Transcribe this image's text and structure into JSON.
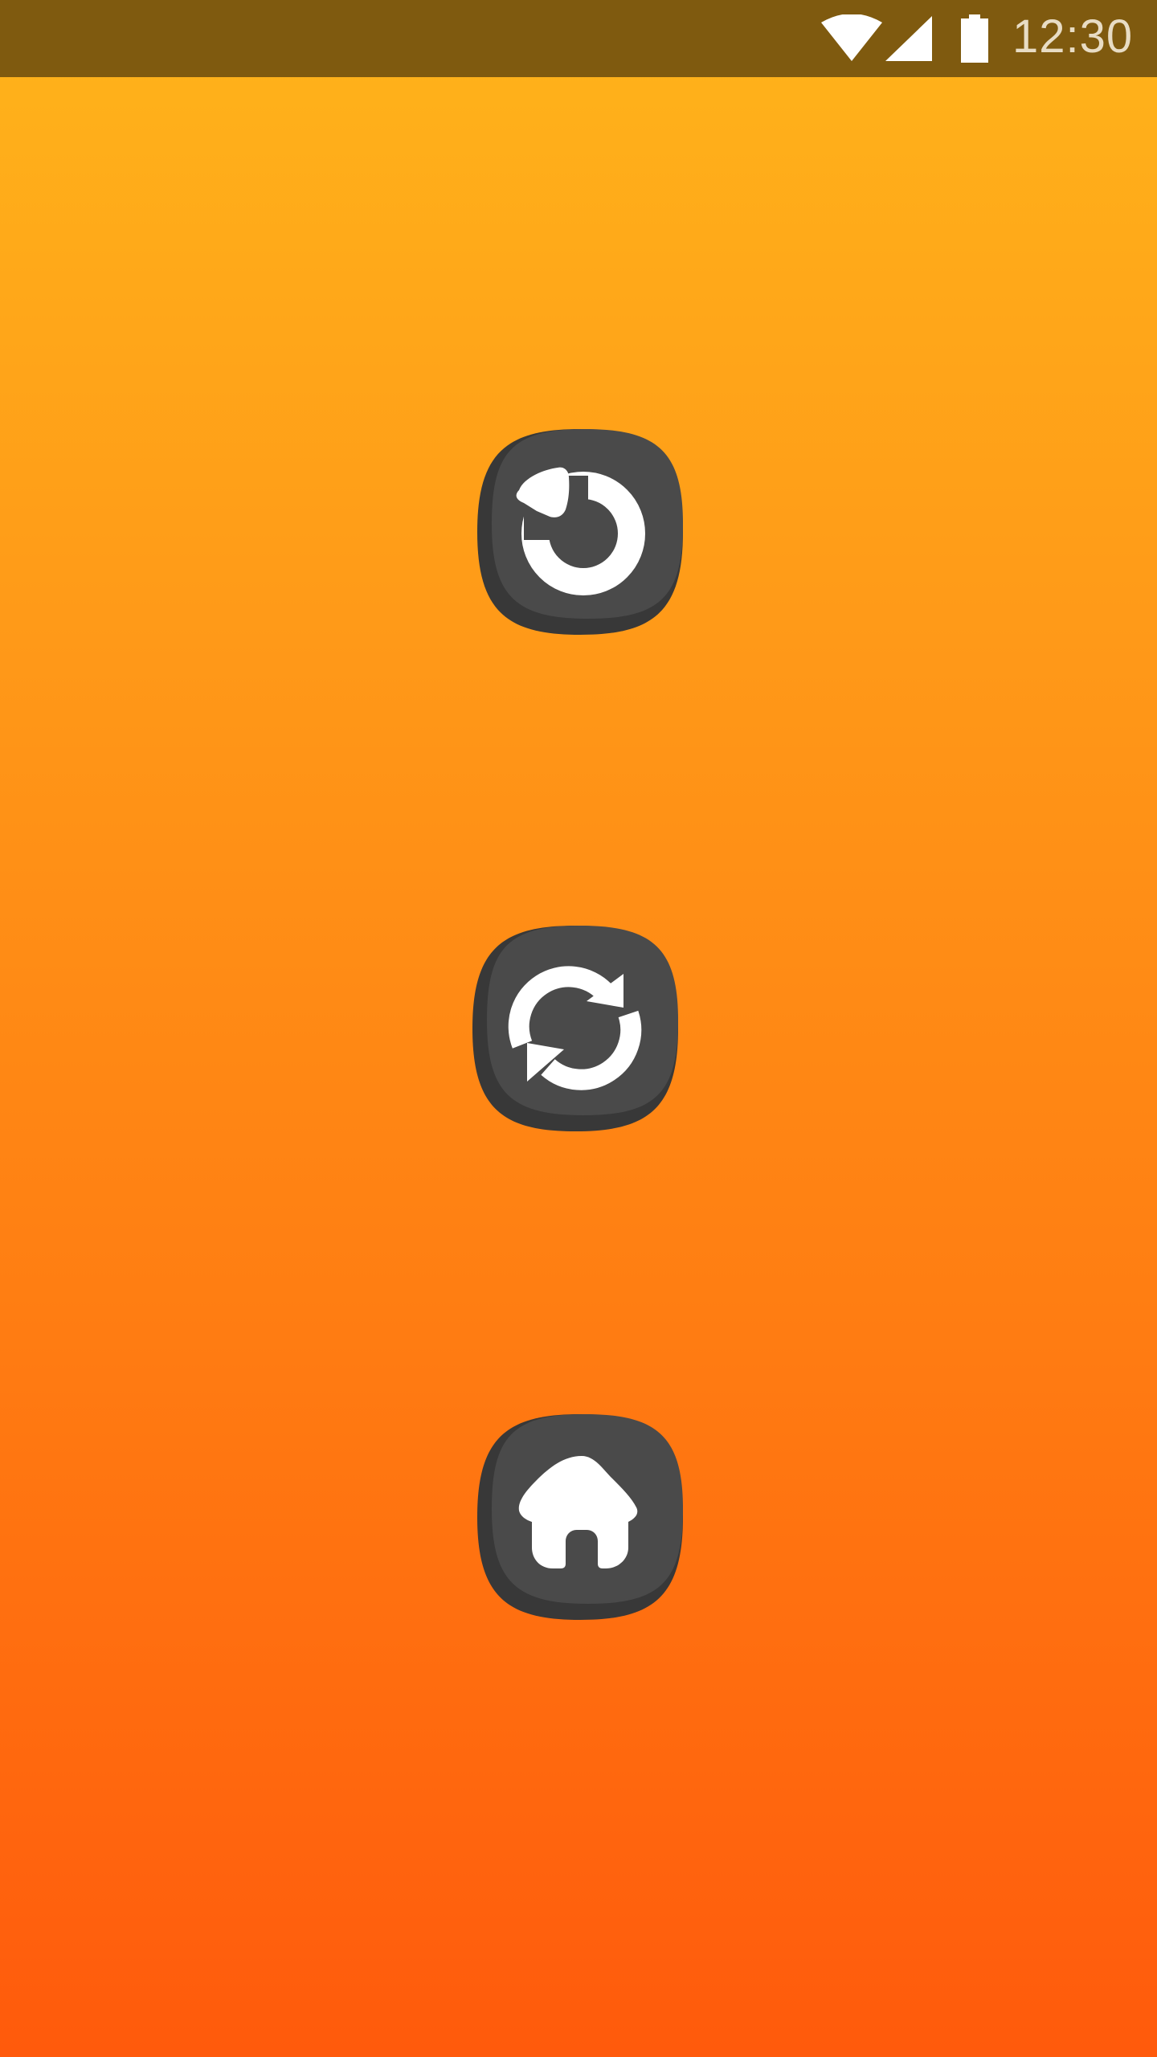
{
  "status_bar": {
    "time": "12:30",
    "icons": [
      "wifi-icon",
      "signal-icon",
      "battery-icon"
    ],
    "background_color": "#7F5A0F"
  },
  "buttons": [
    {
      "name": "undo-button",
      "icon": "undo-icon"
    },
    {
      "name": "refresh-button",
      "icon": "refresh-icon"
    },
    {
      "name": "home-button",
      "icon": "home-icon"
    }
  ],
  "colors": {
    "button_face": "#4A4A4A",
    "button_shadow": "#383838",
    "icon": "#FFFFFF",
    "gradient_top": "#FFB41A",
    "gradient_bottom": "#FF5A0C"
  }
}
